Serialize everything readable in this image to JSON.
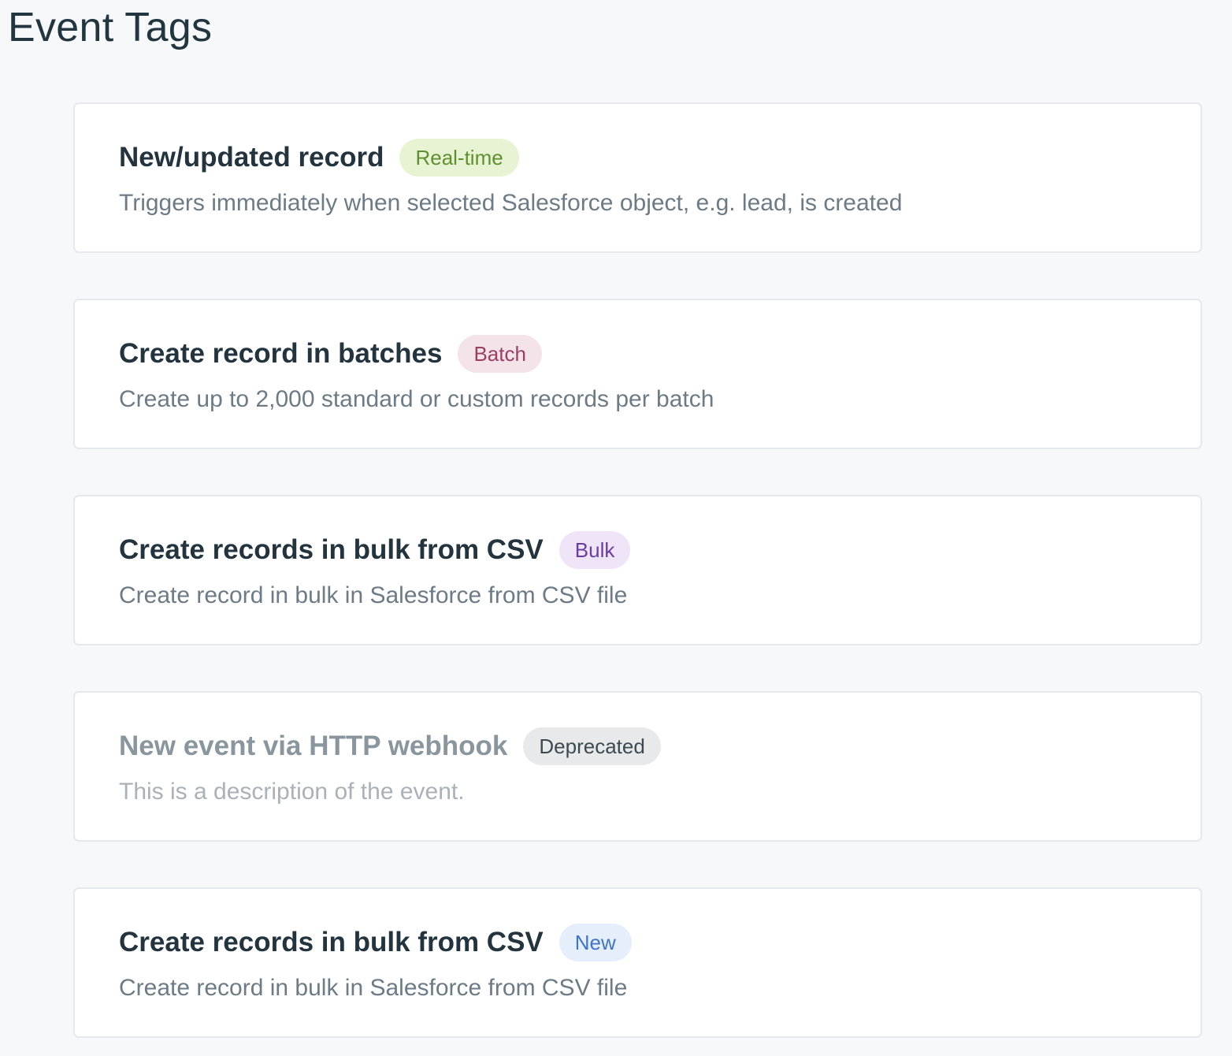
{
  "page": {
    "title": "Event Tags"
  },
  "cards": [
    {
      "title": "New/updated record",
      "badge": "Real-time",
      "description": "Triggers immediately when selected Salesforce object, e.g. lead, is created",
      "badge_color": "#5f8f2e",
      "badge_bg": "#e7f3d3"
    },
    {
      "title": "Create record in batches",
      "badge": "Batch",
      "description": "Create up to 2,000 standard or custom records per batch",
      "badge_color": "#9a3f62",
      "badge_bg": "#f5e3ea"
    },
    {
      "title": "Create records in bulk from CSV",
      "badge": "Bulk",
      "description": "Create record in bulk in Salesforce from CSV file",
      "badge_color": "#6a3ea1",
      "badge_bg": "#f0e4f8"
    },
    {
      "title": "New event via HTTP webhook",
      "badge": "Deprecated",
      "description": "This is a description of the event.",
      "badge_color": "#3d4a52",
      "badge_bg": "#e7e9eb"
    },
    {
      "title": "Create records in bulk from CSV",
      "badge": "New",
      "description": "Create record in bulk in Salesforce from CSV file",
      "badge_color": "#3f74c7",
      "badge_bg": "#e5eefb"
    }
  ]
}
